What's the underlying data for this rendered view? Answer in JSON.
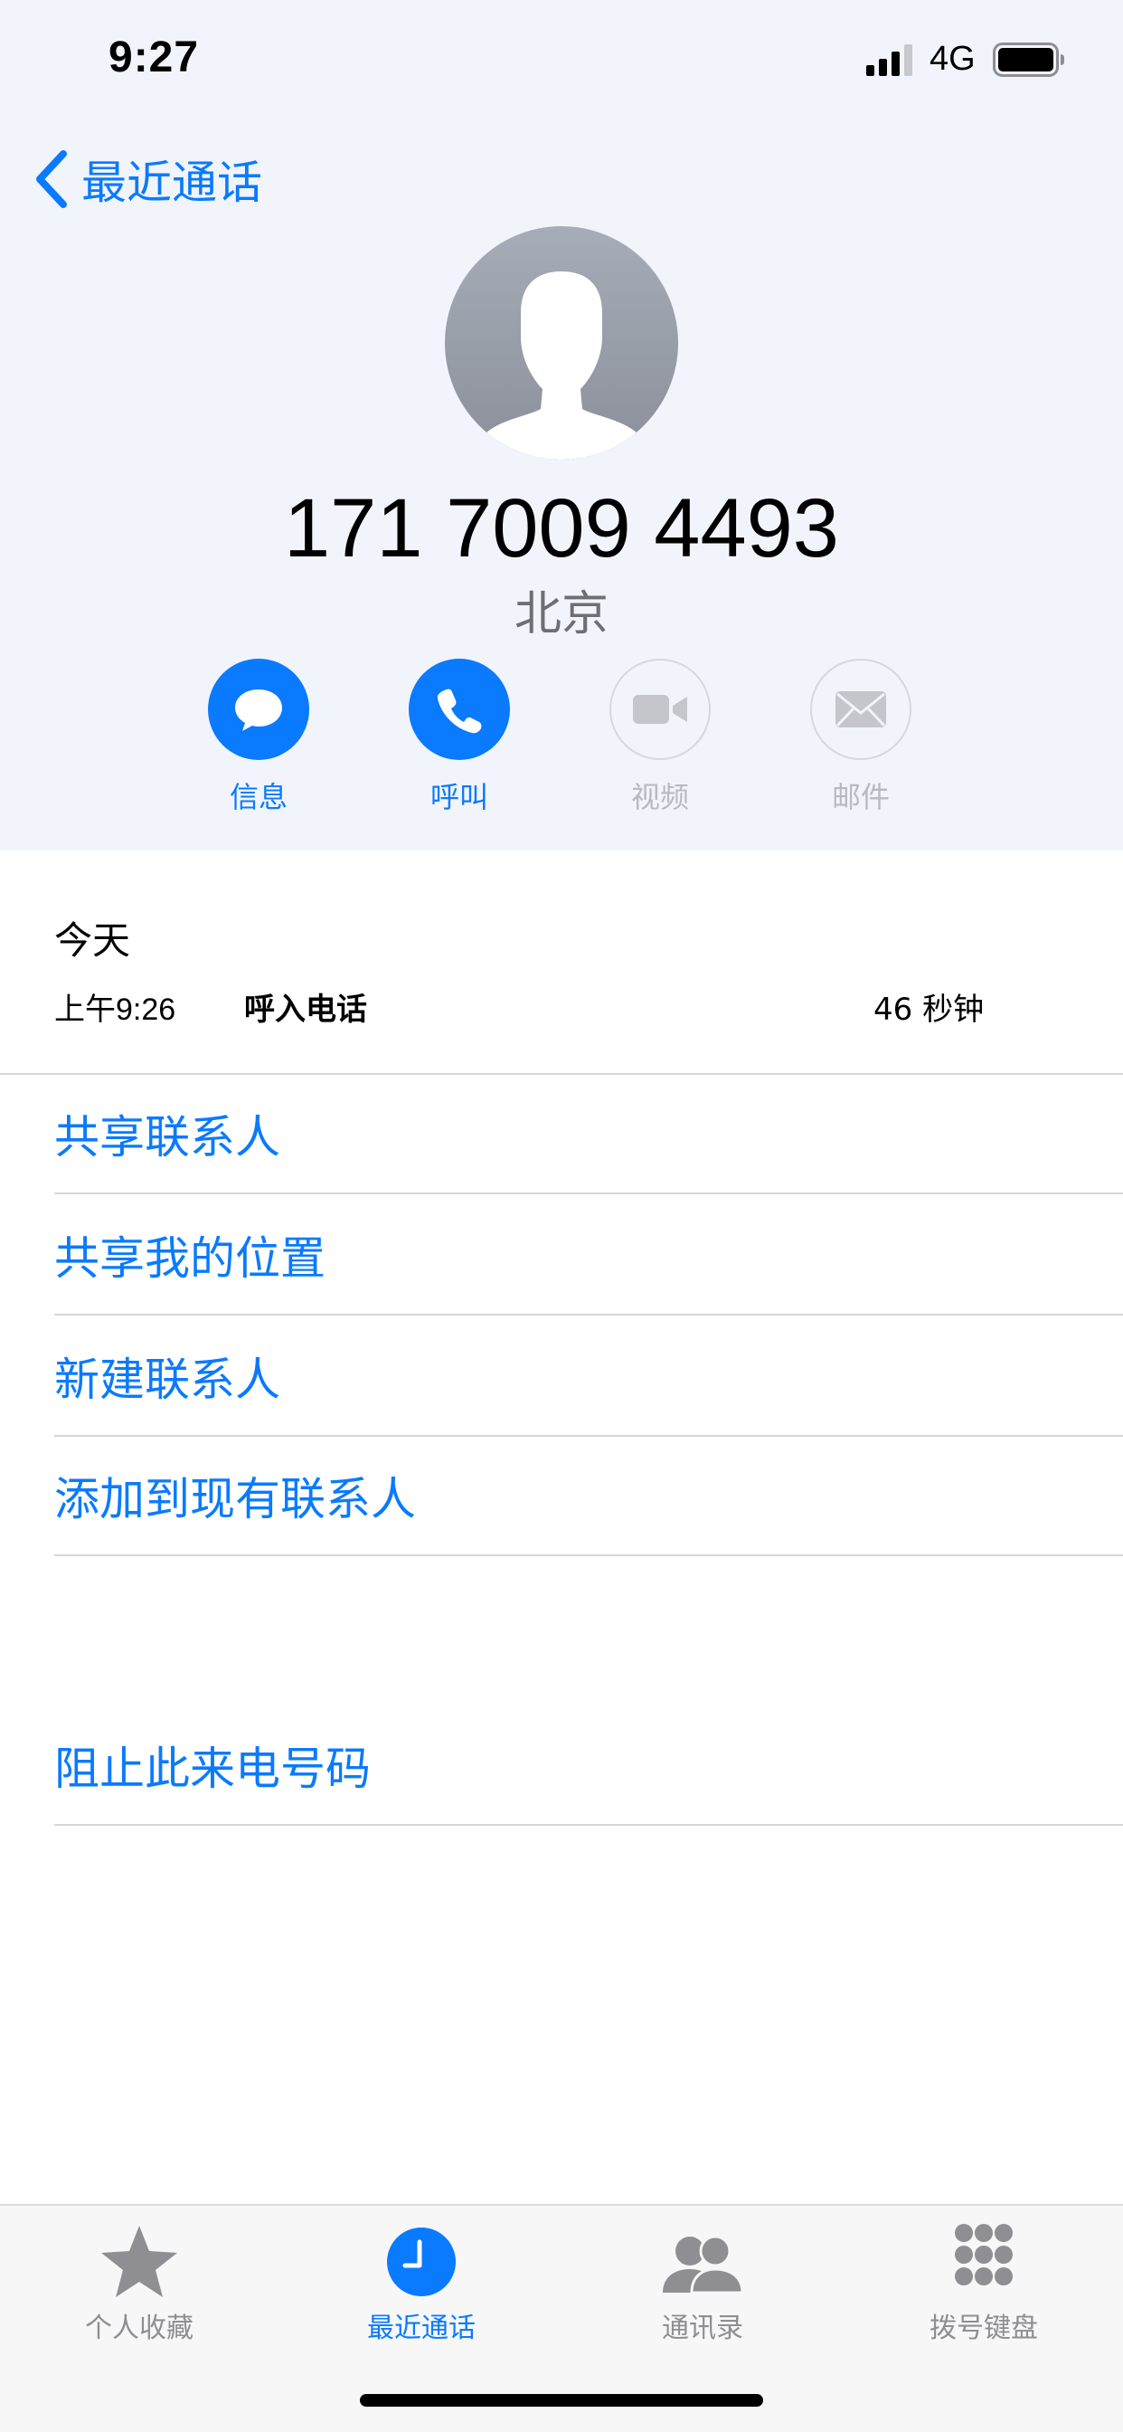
{
  "status_bar": {
    "time": "9:27",
    "network": "4G"
  },
  "nav": {
    "back_label": "最近通话"
  },
  "contact": {
    "phone_number": "171 7009 4493",
    "location": "北京"
  },
  "actions": [
    {
      "label": "信息",
      "icon": "message-bubble-icon",
      "enabled": true
    },
    {
      "label": "呼叫",
      "icon": "phone-icon",
      "enabled": true
    },
    {
      "label": "视频",
      "icon": "video-camera-icon",
      "enabled": false
    },
    {
      "label": "邮件",
      "icon": "envelope-icon",
      "enabled": false
    }
  ],
  "call_log": {
    "date": "今天",
    "time": "上午9:26",
    "type": "呼入电话",
    "duration": "46 秒钟"
  },
  "options": [
    "共享联系人",
    "共享我的位置",
    "新建联系人",
    "添加到现有联系人"
  ],
  "block_label": "阻止此来电号码",
  "tab_bar": {
    "tabs": [
      {
        "label": "个人收藏",
        "icon": "star-icon",
        "active": false
      },
      {
        "label": "最近通话",
        "icon": "clock-icon",
        "active": true
      },
      {
        "label": "通讯录",
        "icon": "contacts-icon",
        "active": false
      },
      {
        "label": "拨号键盘",
        "icon": "keypad-icon",
        "active": false
      }
    ]
  },
  "colors": {
    "accent": "#0a7aff",
    "header_bg": "#f2f4fb",
    "disabled": "#b7bac1",
    "inactive_tab": "#8e8e93"
  }
}
